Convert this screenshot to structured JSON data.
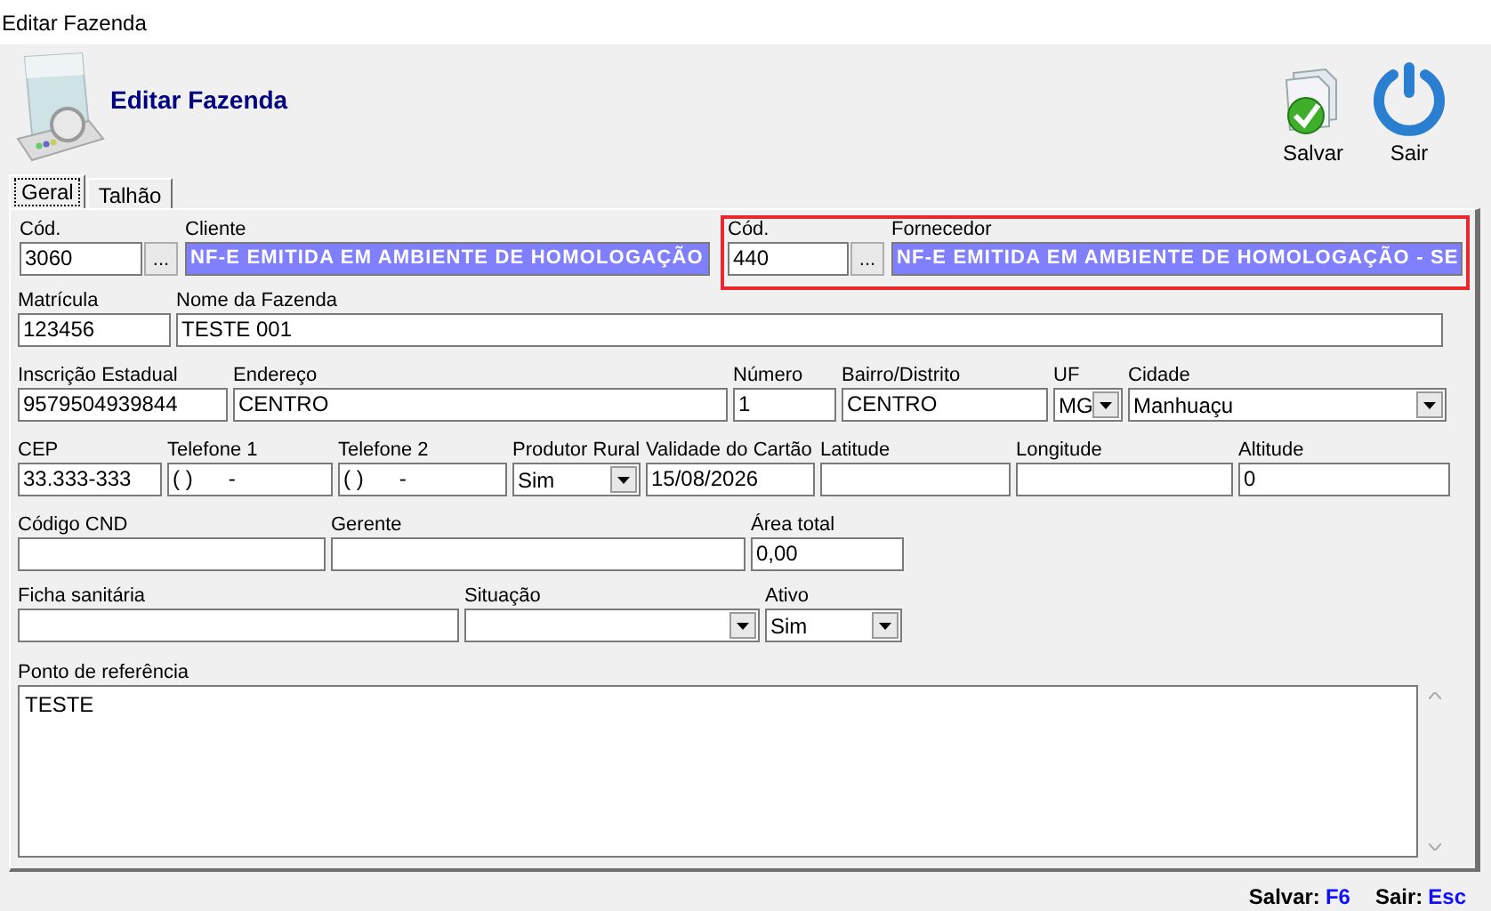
{
  "window": {
    "title": "Editar Fazenda"
  },
  "header": {
    "title": "Editar Fazenda"
  },
  "toolbar": [
    {
      "kind": "save",
      "label": "Salvar"
    },
    {
      "kind": "exit",
      "label": "Sair"
    }
  ],
  "tabs": [
    {
      "label": "Geral",
      "selected": true
    },
    {
      "label": "Talhão",
      "selected": false
    }
  ],
  "rows": [
    [
      {
        "kind": "lookup",
        "code_label": "Cód.",
        "code": "3060",
        "button": "...",
        "name_label": "Cliente",
        "name": "NF-E EMITIDA EM AMBIENTE DE HOMOLOGAÇÃO",
        "highlighted": false
      },
      {
        "kind": "lookup",
        "code_label": "Cód.",
        "code": "440",
        "button": "...",
        "name_label": "Fornecedor",
        "name": "NF-E EMITIDA EM AMBIENTE DE HOMOLOGAÇÃO - SE",
        "highlighted": true
      }
    ],
    [
      {
        "kind": "text",
        "label": "Matrícula",
        "value": "123456"
      },
      {
        "kind": "text",
        "label": "Nome da Fazenda",
        "value": "TESTE 001"
      }
    ],
    [
      {
        "kind": "text",
        "label": "Inscrição Estadual",
        "value": "9579504939844"
      },
      {
        "kind": "text",
        "label": "Endereço",
        "value": "CENTRO"
      },
      {
        "kind": "text",
        "label": "Número",
        "value": "1"
      },
      {
        "kind": "text",
        "label": "Bairro/Distrito",
        "value": "CENTRO"
      },
      {
        "kind": "select",
        "label": "UF",
        "value": "MG"
      },
      {
        "kind": "select",
        "label": "Cidade",
        "value": "Manhuaçu"
      }
    ],
    [
      {
        "kind": "text",
        "label": "CEP",
        "value": "33.333-333"
      },
      {
        "kind": "text",
        "label": "Telefone 1",
        "value": "( )      -"
      },
      {
        "kind": "text",
        "label": "Telefone 2",
        "value": "( )      -"
      },
      {
        "kind": "select",
        "label": "Produtor Rural",
        "value": "Sim"
      },
      {
        "kind": "text",
        "label": "Validade do Cartão",
        "value": "15/08/2026"
      },
      {
        "kind": "text",
        "label": "Latitude"
      },
      {
        "kind": "text",
        "label": "Longitude"
      },
      {
        "kind": "text",
        "label": "Altitude",
        "value": "0"
      }
    ],
    [
      {
        "kind": "text",
        "label": "Código CND"
      },
      {
        "kind": "text",
        "label": "Gerente"
      },
      {
        "kind": "text",
        "label": "Área total",
        "value": "0,00"
      }
    ],
    [
      {
        "kind": "text",
        "label": "Ficha sanitária"
      },
      {
        "kind": "select",
        "label": "Situação"
      },
      {
        "kind": "select",
        "label": "Ativo",
        "value": "Sim"
      }
    ],
    [
      {
        "kind": "textarea",
        "label": "Ponto de referência",
        "value": "TESTE"
      }
    ]
  ],
  "shortcuts": [
    {
      "label": "Salvar:",
      "key": "F6"
    },
    {
      "label": "Sair:",
      "key": "Esc"
    }
  ]
}
